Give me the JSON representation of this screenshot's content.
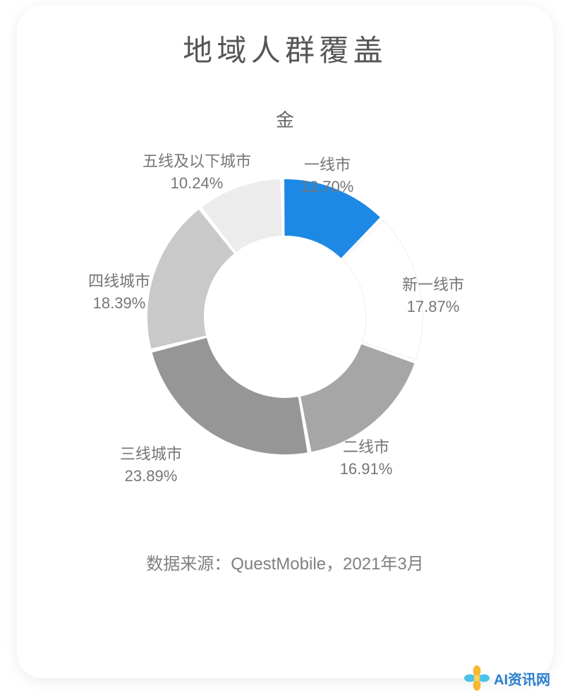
{
  "title": "地域人群覆盖",
  "center_label": "金",
  "source": "数据来源：QuestMobile，2021年3月",
  "watermark": "AI资讯网",
  "labels": {
    "seg0_name": "一线市",
    "seg0_pct": "12.70%",
    "seg1_name": "新一线市",
    "seg1_pct": "17.87%",
    "seg2_name": "二线市",
    "seg2_pct": "16.91%",
    "seg3_name": "三线城市",
    "seg3_pct": "23.89%",
    "seg4_name": "四线城市",
    "seg4_pct": "18.39%",
    "seg5_name": "五线及以下城市",
    "seg5_pct": "10.24%"
  },
  "chart_data": {
    "type": "pie",
    "title": "地域人群覆盖",
    "series": [
      {
        "name": "地域人群覆盖",
        "data": [
          {
            "category": "一线城市",
            "value": 12.7,
            "color": "#1e88e5"
          },
          {
            "category": "新一线城市",
            "value": 17.87,
            "color": "#ffffff"
          },
          {
            "category": "二线城市",
            "value": 16.91,
            "color": "#a6a6a6"
          },
          {
            "category": "三线城市",
            "value": 23.89,
            "color": "#969696"
          },
          {
            "category": "四线城市",
            "value": 18.39,
            "color": "#c9c9c9"
          },
          {
            "category": "五线及以下城市",
            "value": 10.24,
            "color": "#ececec"
          }
        ]
      }
    ],
    "donut": true,
    "source": "QuestMobile，2021年3月"
  }
}
